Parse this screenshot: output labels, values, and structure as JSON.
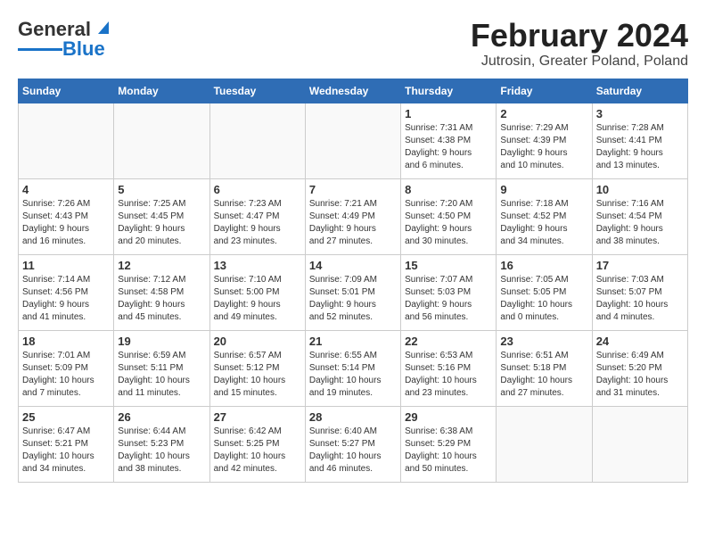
{
  "logo": {
    "text1": "General",
    "text2": "Blue"
  },
  "title": "February 2024",
  "location": "Jutrosin, Greater Poland, Poland",
  "days_of_week": [
    "Sunday",
    "Monday",
    "Tuesday",
    "Wednesday",
    "Thursday",
    "Friday",
    "Saturday"
  ],
  "weeks": [
    [
      {
        "day": "",
        "info": ""
      },
      {
        "day": "",
        "info": ""
      },
      {
        "day": "",
        "info": ""
      },
      {
        "day": "",
        "info": ""
      },
      {
        "day": "1",
        "info": "Sunrise: 7:31 AM\nSunset: 4:38 PM\nDaylight: 9 hours\nand 6 minutes."
      },
      {
        "day": "2",
        "info": "Sunrise: 7:29 AM\nSunset: 4:39 PM\nDaylight: 9 hours\nand 10 minutes."
      },
      {
        "day": "3",
        "info": "Sunrise: 7:28 AM\nSunset: 4:41 PM\nDaylight: 9 hours\nand 13 minutes."
      }
    ],
    [
      {
        "day": "4",
        "info": "Sunrise: 7:26 AM\nSunset: 4:43 PM\nDaylight: 9 hours\nand 16 minutes."
      },
      {
        "day": "5",
        "info": "Sunrise: 7:25 AM\nSunset: 4:45 PM\nDaylight: 9 hours\nand 20 minutes."
      },
      {
        "day": "6",
        "info": "Sunrise: 7:23 AM\nSunset: 4:47 PM\nDaylight: 9 hours\nand 23 minutes."
      },
      {
        "day": "7",
        "info": "Sunrise: 7:21 AM\nSunset: 4:49 PM\nDaylight: 9 hours\nand 27 minutes."
      },
      {
        "day": "8",
        "info": "Sunrise: 7:20 AM\nSunset: 4:50 PM\nDaylight: 9 hours\nand 30 minutes."
      },
      {
        "day": "9",
        "info": "Sunrise: 7:18 AM\nSunset: 4:52 PM\nDaylight: 9 hours\nand 34 minutes."
      },
      {
        "day": "10",
        "info": "Sunrise: 7:16 AM\nSunset: 4:54 PM\nDaylight: 9 hours\nand 38 minutes."
      }
    ],
    [
      {
        "day": "11",
        "info": "Sunrise: 7:14 AM\nSunset: 4:56 PM\nDaylight: 9 hours\nand 41 minutes."
      },
      {
        "day": "12",
        "info": "Sunrise: 7:12 AM\nSunset: 4:58 PM\nDaylight: 9 hours\nand 45 minutes."
      },
      {
        "day": "13",
        "info": "Sunrise: 7:10 AM\nSunset: 5:00 PM\nDaylight: 9 hours\nand 49 minutes."
      },
      {
        "day": "14",
        "info": "Sunrise: 7:09 AM\nSunset: 5:01 PM\nDaylight: 9 hours\nand 52 minutes."
      },
      {
        "day": "15",
        "info": "Sunrise: 7:07 AM\nSunset: 5:03 PM\nDaylight: 9 hours\nand 56 minutes."
      },
      {
        "day": "16",
        "info": "Sunrise: 7:05 AM\nSunset: 5:05 PM\nDaylight: 10 hours\nand 0 minutes."
      },
      {
        "day": "17",
        "info": "Sunrise: 7:03 AM\nSunset: 5:07 PM\nDaylight: 10 hours\nand 4 minutes."
      }
    ],
    [
      {
        "day": "18",
        "info": "Sunrise: 7:01 AM\nSunset: 5:09 PM\nDaylight: 10 hours\nand 7 minutes."
      },
      {
        "day": "19",
        "info": "Sunrise: 6:59 AM\nSunset: 5:11 PM\nDaylight: 10 hours\nand 11 minutes."
      },
      {
        "day": "20",
        "info": "Sunrise: 6:57 AM\nSunset: 5:12 PM\nDaylight: 10 hours\nand 15 minutes."
      },
      {
        "day": "21",
        "info": "Sunrise: 6:55 AM\nSunset: 5:14 PM\nDaylight: 10 hours\nand 19 minutes."
      },
      {
        "day": "22",
        "info": "Sunrise: 6:53 AM\nSunset: 5:16 PM\nDaylight: 10 hours\nand 23 minutes."
      },
      {
        "day": "23",
        "info": "Sunrise: 6:51 AM\nSunset: 5:18 PM\nDaylight: 10 hours\nand 27 minutes."
      },
      {
        "day": "24",
        "info": "Sunrise: 6:49 AM\nSunset: 5:20 PM\nDaylight: 10 hours\nand 31 minutes."
      }
    ],
    [
      {
        "day": "25",
        "info": "Sunrise: 6:47 AM\nSunset: 5:21 PM\nDaylight: 10 hours\nand 34 minutes."
      },
      {
        "day": "26",
        "info": "Sunrise: 6:44 AM\nSunset: 5:23 PM\nDaylight: 10 hours\nand 38 minutes."
      },
      {
        "day": "27",
        "info": "Sunrise: 6:42 AM\nSunset: 5:25 PM\nDaylight: 10 hours\nand 42 minutes."
      },
      {
        "day": "28",
        "info": "Sunrise: 6:40 AM\nSunset: 5:27 PM\nDaylight: 10 hours\nand 46 minutes."
      },
      {
        "day": "29",
        "info": "Sunrise: 6:38 AM\nSunset: 5:29 PM\nDaylight: 10 hours\nand 50 minutes."
      },
      {
        "day": "",
        "info": ""
      },
      {
        "day": "",
        "info": ""
      }
    ]
  ]
}
